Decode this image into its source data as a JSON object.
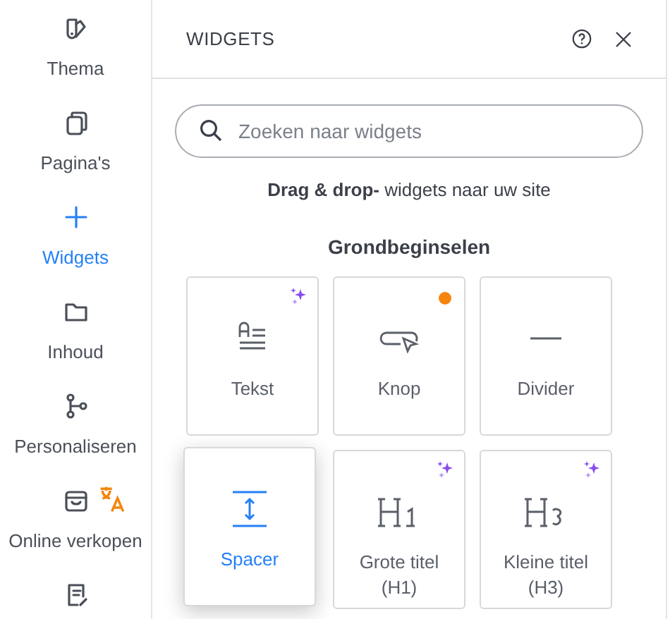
{
  "sidebar": {
    "items": [
      {
        "label": "Thema",
        "selected": false,
        "translation_badge": false
      },
      {
        "label": "Pagina's",
        "selected": false,
        "translation_badge": false
      },
      {
        "label": "Widgets",
        "selected": true,
        "translation_badge": false
      },
      {
        "label": "Inhoud",
        "selected": false,
        "translation_badge": false
      },
      {
        "label": "Personaliseren",
        "selected": false,
        "translation_badge": false
      },
      {
        "label": "Online verkopen",
        "selected": false,
        "translation_badge": true
      },
      {
        "selected": false,
        "translation_badge": false
      }
    ]
  },
  "panel": {
    "title": "WIDGETS",
    "search": {
      "placeholder": "Zoeken naar widgets"
    },
    "hint": "**Drag & drop-** widgets naar uw site",
    "section_title": "Grondbeginselen",
    "widgets": [
      {
        "label": "Tekst",
        "sparkle": true,
        "dot": false,
        "highlighted": false
      },
      {
        "label": "Knop",
        "sparkle": false,
        "dot": true,
        "highlighted": false
      },
      {
        "label": "Divider",
        "sparkle": false,
        "dot": false,
        "highlighted": false
      },
      {
        "label": "Spacer",
        "sparkle": false,
        "dot": false,
        "highlighted": true
      },
      {
        "label": "Grote titel (H1)",
        "sparkle": true,
        "dot": false,
        "highlighted": false
      },
      {
        "label": "Kleine titel (H3)",
        "sparkle": true,
        "dot": false,
        "highlighted": false
      }
    ]
  }
}
